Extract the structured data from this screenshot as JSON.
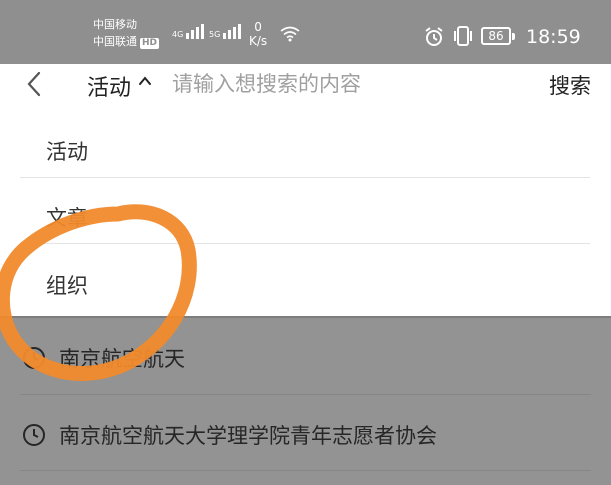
{
  "status_bar": {
    "carrier_1": "中国移动",
    "carrier_2": "中国联通",
    "hd_badge": "HD",
    "signal_1_type": "4G",
    "signal_2_type": "5G",
    "net_speed_value": "0",
    "net_speed_unit": "K/s",
    "battery_level": "86",
    "time": "18:59",
    "icons": [
      "wifi-icon",
      "alarm-icon",
      "vibrate-icon",
      "battery-icon"
    ]
  },
  "search_bar": {
    "back_icon": "chevron-left-icon",
    "scope_label": "活动",
    "scope_caret_icon": "caret-up-icon",
    "placeholder": "请输入想搜索的内容",
    "search_button": "搜索"
  },
  "scope_menu": {
    "items": [
      {
        "label": "活动"
      },
      {
        "label": "文章"
      },
      {
        "label": "组织"
      }
    ]
  },
  "search_history": {
    "items": [
      {
        "label": "南京航空航天",
        "icon": "clock-icon"
      },
      {
        "label": "南京航空航天大学理学院青年志愿者协会",
        "icon": "clock-icon"
      }
    ]
  },
  "colors": {
    "status_bar_bg": "#8f8f8f",
    "overlay_bg": "#939393",
    "annotation": "#f08a2c"
  }
}
